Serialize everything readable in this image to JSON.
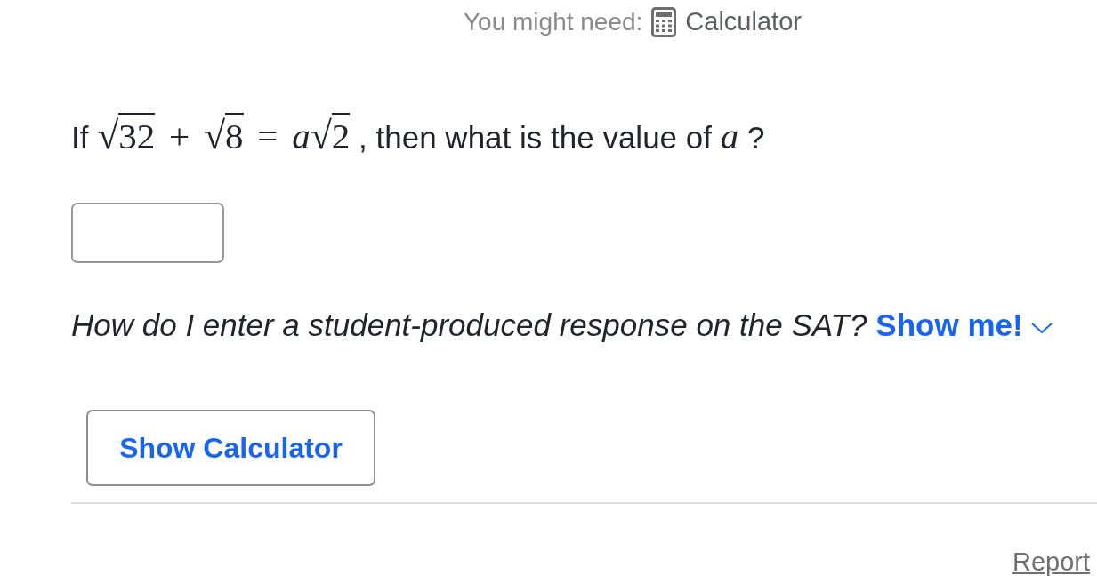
{
  "header": {
    "label": "You might need:",
    "tool": "Calculator"
  },
  "question": [
    {
      "kind": "text",
      "text": "If"
    },
    {
      "kind": "radical",
      "sign": "√",
      "radicand": "32"
    },
    {
      "kind": "operator",
      "text": "+"
    },
    {
      "kind": "radical",
      "sign": "√",
      "radicand": "8"
    },
    {
      "kind": "operator",
      "text": "="
    },
    {
      "kind": "variable",
      "text": "a"
    },
    {
      "kind": "radical",
      "sign": "√",
      "radicand": "2"
    },
    {
      "kind": "text",
      "text": ", then what is the value of"
    },
    {
      "kind": "variable",
      "text": "a"
    },
    {
      "kind": "text",
      "text": "?"
    }
  ],
  "help": {
    "question": "How do I enter a student-produced response on the SAT?",
    "link": "Show me!",
    "expanded": false
  },
  "calculator_button": {
    "label": "Show Calculator"
  },
  "footer_link": "Report"
}
